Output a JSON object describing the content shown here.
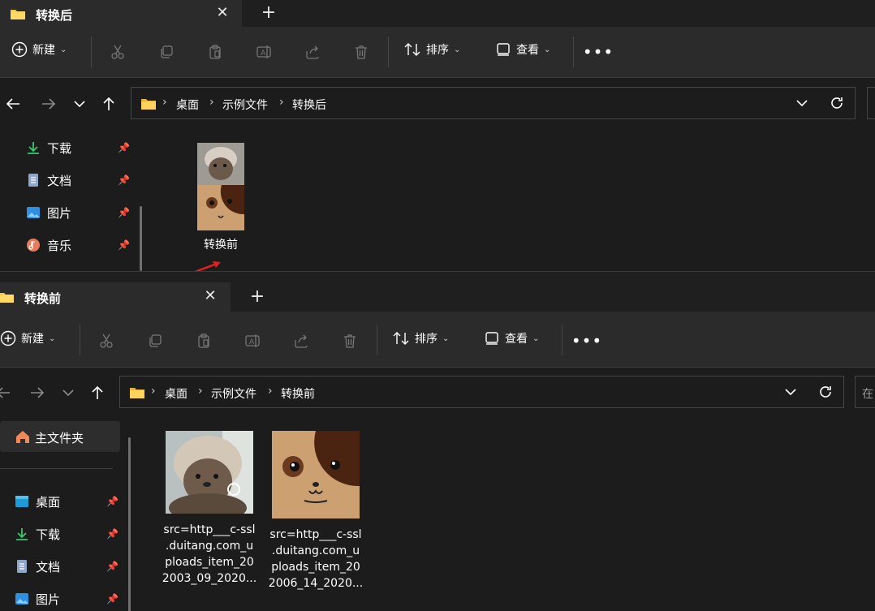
{
  "window_top": {
    "tab": {
      "title": "转换后"
    },
    "toolbar": {
      "new_label": "新建",
      "sort_label": "排序",
      "view_label": "查看"
    },
    "breadcrumb": [
      "桌面",
      "示例文件",
      "转换后"
    ],
    "sidebar": [
      {
        "label": "下载",
        "icon": "download-icon"
      },
      {
        "label": "文档",
        "icon": "document-icon"
      },
      {
        "label": "图片",
        "icon": "picture-icon"
      },
      {
        "label": "音乐",
        "icon": "music-icon"
      }
    ],
    "files": [
      {
        "name": "转换前",
        "type": "image-thumbnail"
      }
    ]
  },
  "window_bottom": {
    "tab": {
      "title": "转换前"
    },
    "toolbar": {
      "new_label": "新建",
      "sort_label": "排序",
      "view_label": "查看"
    },
    "breadcrumb": [
      "桌面",
      "示例文件",
      "转换前"
    ],
    "search_placeholder": "在",
    "sidebar_home": "主文件夹",
    "sidebar": [
      {
        "label": "桌面",
        "icon": "desktop-icon"
      },
      {
        "label": "下载",
        "icon": "download-icon"
      },
      {
        "label": "文档",
        "icon": "document-icon"
      },
      {
        "label": "图片",
        "icon": "picture-icon"
      }
    ],
    "files": [
      {
        "line1": "src=http___c-ssl",
        "line2": ".duitang.com_u",
        "line3": "ploads_item_20",
        "line4": "2003_09_2020..."
      },
      {
        "line1": "src=http___c-ssl",
        "line2": ".duitang.com_u",
        "line3": "ploads_item_20",
        "line4": "2006_14_2020..."
      }
    ]
  },
  "colors": {
    "folder": "#f5c542",
    "accent": "#4cc2ff",
    "bg": "#1c1c1c",
    "toolbar": "#2b2b2b"
  }
}
